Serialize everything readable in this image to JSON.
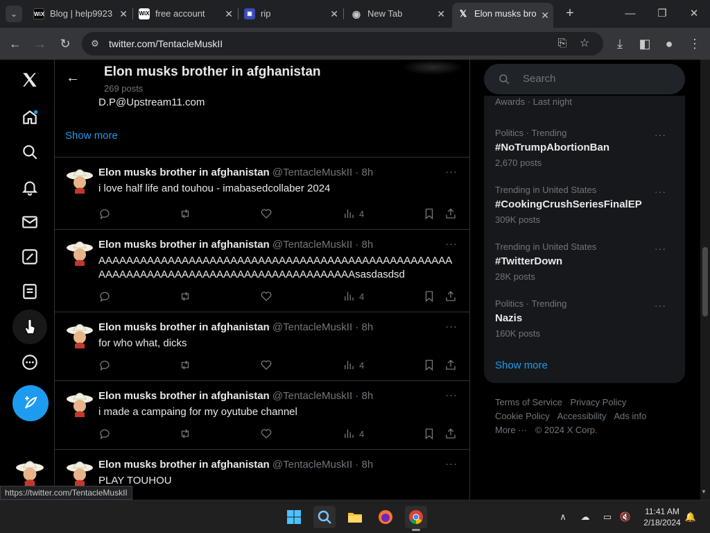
{
  "browser": {
    "tabs": [
      {
        "label": "Blog | help9923",
        "favicon": "wix-icon",
        "fav_color": "#ffffff",
        "fav_bg": "#000000",
        "fav_text": "WiX",
        "active": false
      },
      {
        "label": "free account",
        "favicon": "wix-icon",
        "fav_color": "#000000",
        "fav_bg": "#ffffff",
        "fav_text": "WiX",
        "active": false
      },
      {
        "label": "rip",
        "favicon": "window-icon",
        "fav_color": "#ffffff",
        "fav_bg": "#3b4bb8",
        "fav_text": "▣",
        "active": false
      },
      {
        "label": "New Tab",
        "favicon": "chrome-icon",
        "fav_color": "#c7c7c7",
        "fav_bg": "transparent",
        "fav_text": "◉",
        "active": false
      },
      {
        "label": "Elon musks bro",
        "favicon": "x-logo-icon",
        "fav_color": "#ffffff",
        "fav_bg": "transparent",
        "fav_text": "𝕏",
        "active": true
      }
    ],
    "url": "twitter.com/TentacleMuskII",
    "status_url": "https://twitter.com/TentacleMuskII"
  },
  "profile": {
    "title": "Elon musks brother in afghanistan",
    "posts_count": "269 posts",
    "bio_line": "D.P@Upstream11.com",
    "show_more": "Show more"
  },
  "tweets": [
    {
      "name": "Elon musks brother in afghanistan",
      "handle": "@TentacleMuskII · 8h",
      "text": "i love half life and touhou - imabasedcollaber 2024",
      "views": "4"
    },
    {
      "name": "Elon musks brother in afghanistan",
      "handle": "@TentacleMuskII · 8h",
      "text": "AAAAAAAAAAAAAAAAAAAAAAAAAAAAAAAAAAAAAAAAAAAAAAAAAAAAAAAAAAAAAAAAAAAAAAAAAAAAAAAAAAAAAAAAsasdasdsd",
      "views": "4"
    },
    {
      "name": "Elon musks brother in afghanistan",
      "handle": "@TentacleMuskII · 8h",
      "text": "for who what, dicks",
      "views": "4"
    },
    {
      "name": "Elon musks brother in afghanistan",
      "handle": "@TentacleMuskII · 8h",
      "text": "i made a campaing for my oyutube channel",
      "views": "4"
    },
    {
      "name": "Elon musks brother in afghanistan",
      "handle": "@TentacleMuskII · 8h",
      "text": "PLAY TOUHOU",
      "views": ""
    }
  ],
  "sidebar": {
    "search_placeholder": "Search",
    "partial_trend": "Awards · Last night",
    "trends": [
      {
        "category": "Politics · Trending",
        "name": "#NoTrumpAbortionBan",
        "count": "2,670 posts"
      },
      {
        "category": "Trending in United States",
        "name": "#CookingCrushSeriesFinalEP",
        "count": "309K posts"
      },
      {
        "category": "Trending in United States",
        "name": "#TwitterDown",
        "count": "28K posts"
      },
      {
        "category": "Politics · Trending",
        "name": "Nazis",
        "count": "160K posts"
      }
    ],
    "show_more": "Show more",
    "footer": {
      "terms": "Terms of Service",
      "privacy": "Privacy Policy",
      "cookie": "Cookie Policy",
      "accessibility": "Accessibility",
      "ads": "Ads info",
      "more": "More ···",
      "copyright": "© 2024 X Corp."
    }
  },
  "taskbar": {
    "time": "11:41 AM",
    "date": "2/18/2024"
  },
  "colors": {
    "accent": "#1d9bf0",
    "background": "#000000",
    "muted": "#71767b"
  }
}
